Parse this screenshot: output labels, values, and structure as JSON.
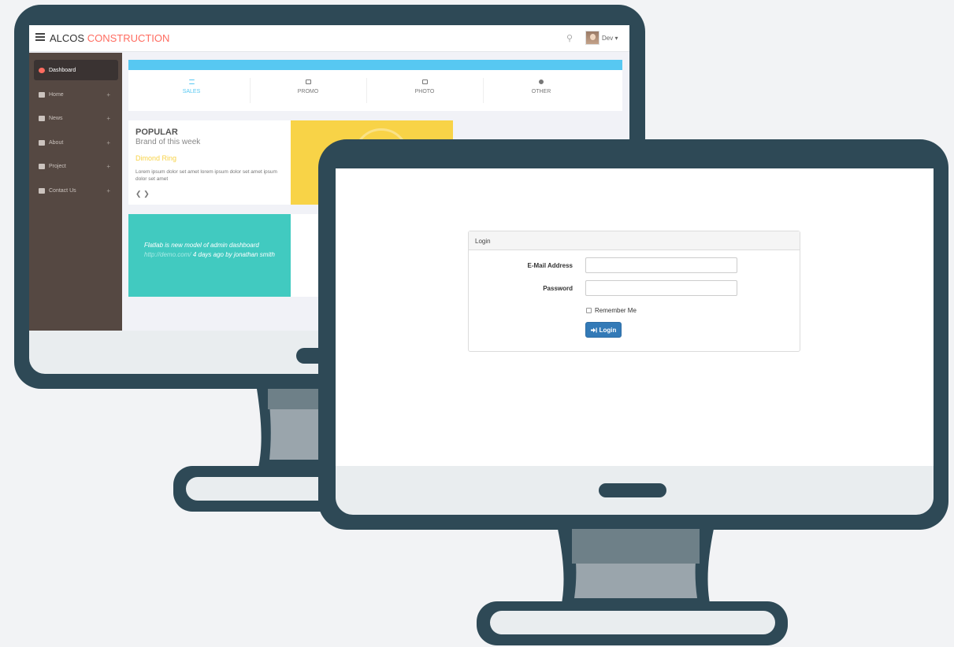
{
  "admin": {
    "brand_main": "ALCOS",
    "brand_accent": "CONSTRUCTION",
    "user_name": "Dev",
    "user_caret": "▾",
    "sidebar": [
      {
        "label": "Dashboard",
        "icon": "dashboard-icon",
        "active": true
      },
      {
        "label": "Home",
        "icon": "home-icon",
        "expand": "+"
      },
      {
        "label": "News",
        "icon": "news-icon",
        "expand": "+"
      },
      {
        "label": "About",
        "icon": "about-icon",
        "expand": "+"
      },
      {
        "label": "Project",
        "icon": "project-icon",
        "expand": "+"
      },
      {
        "label": "Contact Us",
        "icon": "phone-icon",
        "expand": "+"
      }
    ],
    "tabs": [
      {
        "label": "SALES",
        "icon": "list-icon",
        "active": true
      },
      {
        "label": "PROMO",
        "icon": "calendar-icon"
      },
      {
        "label": "PHOTO",
        "icon": "camera-icon"
      },
      {
        "label": "OTHER",
        "icon": "circle-icon"
      }
    ],
    "popular": {
      "title": "POPULAR",
      "subtitle": "Brand of this week",
      "product": "Dimond Ring",
      "text": "Lorem ipsum dolor set amet lorem ipsum dolor set amet ipsum dolor set amet",
      "nav_prev": "❮",
      "nav_next": "❯"
    },
    "twitter": {
      "text_before": "Flatlab is new model of admin dashboard",
      "link": "http://demo.com/",
      "text_after": "4 days ago by jonathan smith"
    },
    "colors": {
      "accent": "#ff6c60",
      "sidebar": "#554842",
      "strip": "#57c8f2",
      "yellow": "#f8d347",
      "teal": "#41cac0",
      "monitor": "#2e4956"
    }
  },
  "login": {
    "heading": "Login",
    "email_label": "E-Mail Address",
    "email_value": "",
    "password_label": "Password",
    "password_value": "",
    "remember_label": "Remember Me",
    "button_label": "Login",
    "button_icon": "sign-in-icon",
    "button_color": "#337ab7"
  }
}
